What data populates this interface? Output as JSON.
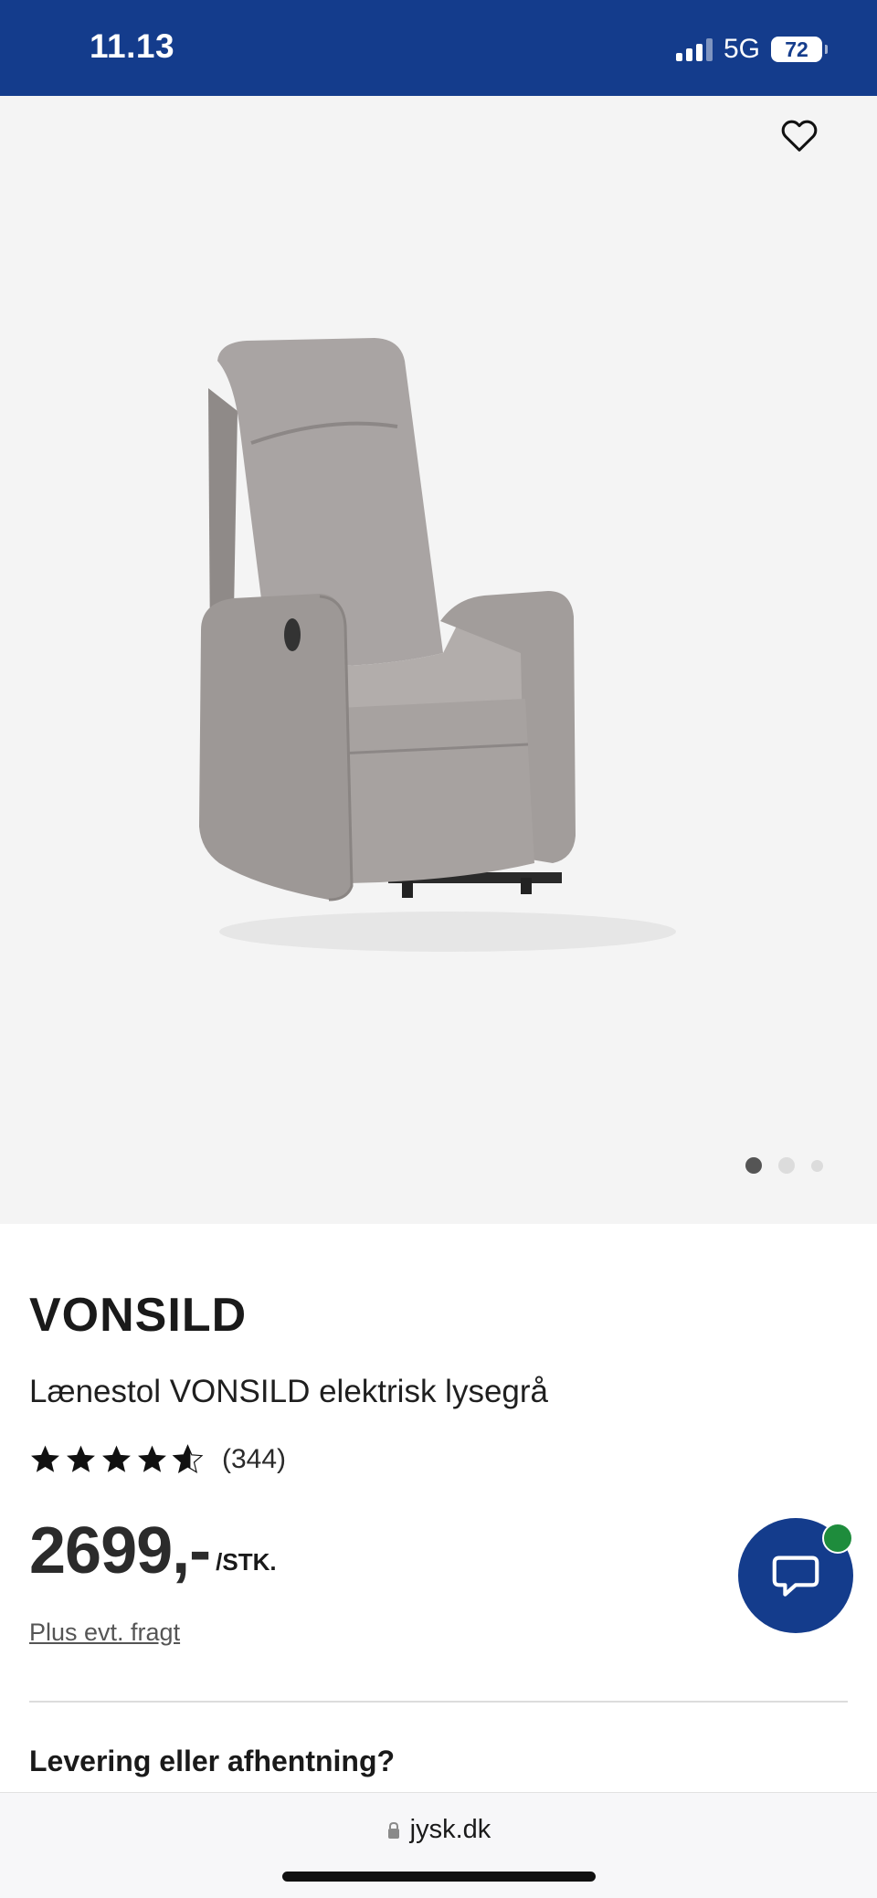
{
  "status_bar": {
    "time": "11.13",
    "network": "5G",
    "battery": "72"
  },
  "product": {
    "brand": "VONSILD",
    "name": "Lænestol VONSILD elektrisk lysegrå",
    "rating_stars": 4.5,
    "review_count": "(344)",
    "price": "2699,-",
    "price_unit": "/STK.",
    "shipping_note": "Plus evt. fragt"
  },
  "gallery": {
    "total_images": 3,
    "active_index": 0
  },
  "sections": {
    "delivery_heading": "Levering eller afhentning?"
  },
  "browser": {
    "url": "jysk.dk"
  },
  "colors": {
    "brand_blue": "#143c8c",
    "badge_green": "#1e8c3c",
    "gallery_bg": "#f4f4f4"
  }
}
